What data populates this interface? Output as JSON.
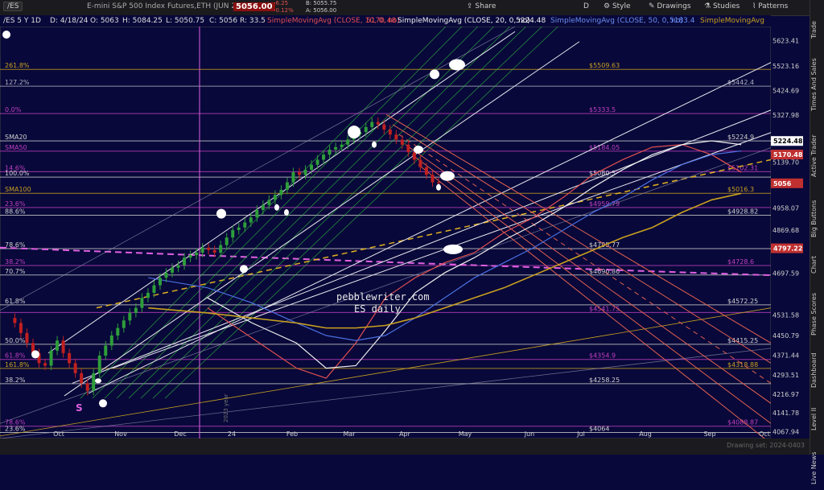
{
  "topbar": {
    "symbol": "/ES",
    "name": "E-mini S&P 500 Index Futures,ETH (JUN 24)",
    "last": "5056.00",
    "change": "-6.25",
    "change_pct": "-0.12%",
    "bid": "B: 5055.75",
    "ask": "A: 5056.00",
    "share": "Share",
    "d": "D",
    "style": "Style",
    "drawings": "Drawings",
    "studies": "Studies",
    "patterns": "Patterns"
  },
  "info": {
    "label": "/ES 5 Y 1D",
    "date": "D: 4/18/24",
    "open": "O: 5063",
    "high": "H: 5084.25",
    "low": "L: 5050.75",
    "close": "C: 5056",
    "range": "R: 33.5",
    "sma10": "SimpleMovingAvg (CLOSE, 10, 0, no)",
    "sma10_val": "5170.48",
    "sma20": "SimpleMovingAvg (CLOSE, 20, 0, no)",
    "sma20_val": "5224.48",
    "sma50": "SimpleMovingAvg (CLOSE, 50, 0, no)",
    "sma50_val": "5183.4",
    "sma100": "SimpleMovingAvg"
  },
  "side_tabs": [
    "Trade",
    "Times And Sales",
    "Active Trader",
    "Big Buttons",
    "Chart",
    "Phase Scores",
    "Dashboard",
    "Level II",
    "Live News"
  ],
  "watermark": {
    "line1": "pebblewriter.com",
    "line2": "ES daily"
  },
  "year_label": "2023 year",
  "drawing_set": "Drawing set: 2024-0403",
  "s_label": "S",
  "colors": {
    "bg": "#08083a",
    "up": "#2e9e3a",
    "down": "#c02020",
    "sma10": "#e05050",
    "sma20": "#f0f0f0",
    "sma50": "#4a6fe0",
    "sma100": "#c8a020",
    "fib": "#c040c0",
    "channel": "#e06050",
    "green_lines": "#30c040"
  },
  "chart_data": {
    "type": "line",
    "title": "",
    "xlabel": "",
    "ylabel": "",
    "x_ticks": [
      "Oct",
      "Nov",
      "Dec",
      "24",
      "Feb",
      "Mar",
      "Apr",
      "May",
      "Jun",
      "Jul",
      "Aug",
      "Sep",
      "Oct"
    ],
    "y_ticks": [
      5623.41,
      5523.16,
      5424.69,
      5327.98,
      5139.7,
      4958.07,
      4869.68,
      4697.59,
      4531.58,
      4450.79,
      4371.44,
      4293.51,
      4216.97,
      4141.78,
      4067.94
    ],
    "ylim": [
      4040,
      5680
    ],
    "price_markers": [
      {
        "label": "5224.48",
        "value": 5224.48,
        "color": "#ffffff"
      },
      {
        "label": "5170.48",
        "value": 5170.48,
        "color": "#c03030"
      },
      {
        "label": "5056",
        "value": 5056,
        "color": "#c03030"
      },
      {
        "label": "4797.22",
        "value": 4797.22,
        "color": "#c03030"
      }
    ],
    "levels": [
      {
        "left": "261.8%",
        "right": "$5509.63",
        "value": 5509.63,
        "color": "#c8a020"
      },
      {
        "left": "127.2%",
        "right": "$5442.4",
        "value": 5442.4,
        "color": "#b0b0c0"
      },
      {
        "left": "0.0%",
        "right": "$5333.5",
        "value": 5333.5,
        "color": "#c040c0"
      },
      {
        "left": "SMA20",
        "right": "$5224.9",
        "value": 5224.9,
        "color": "#d0d0d0"
      },
      {
        "left": "SMA50",
        "right": "$5184.05",
        "value": 5184.05,
        "color": "#c040c0"
      },
      {
        "left": "14.6%",
        "right": "$5102.31",
        "value": 5102.31,
        "color": "#c040c0"
      },
      {
        "left": "100.0%",
        "right": "$5080.5",
        "value": 5080.5,
        "color": "#d0d0d0"
      },
      {
        "left": "SMA100",
        "right": "$5016.3",
        "value": 5016.3,
        "color": "#c8a020"
      },
      {
        "left": "23.6%",
        "right": "$4959.79",
        "value": 4959.79,
        "color": "#c040c0"
      },
      {
        "left": "88.6%",
        "right": "$4928.82",
        "value": 4928.82,
        "color": "#d0d0d0"
      },
      {
        "left": "78.6%",
        "right": "$4795.77",
        "value": 4795.77,
        "color": "#d0d0d0"
      },
      {
        "left": "38.2%",
        "right": "$4728.6",
        "value": 4728.6,
        "color": "#c040c0"
      },
      {
        "left": "70.7%",
        "right": "$4690.86",
        "value": 4690.86,
        "color": "#d0d0d0"
      },
      {
        "left": "61.8%",
        "right": "$4572.25",
        "value": 4572.25,
        "color": "#d0d0d0"
      },
      {
        "left": "",
        "right": "$4541.75",
        "value": 4541.75,
        "color": "#c040c0"
      },
      {
        "left": "50.0%",
        "right": "$4415.25",
        "value": 4415.25,
        "color": "#d0d0d0"
      },
      {
        "left": "61.8%",
        "right": "$4354.9",
        "value": 4354.9,
        "color": "#c040c0"
      },
      {
        "left": "161.8%",
        "right": "$4318.88",
        "value": 4318.88,
        "color": "#c8a020"
      },
      {
        "left": "38.2%",
        "right": "$4258.25",
        "value": 4258.25,
        "color": "#d0d0d0"
      },
      {
        "left": "78.6%",
        "right": "$4088.87",
        "value": 4088.87,
        "color": "#c040c0"
      },
      {
        "left": "23.6%",
        "right": "$4064",
        "value": 4064,
        "color": "#d0d0d0"
      }
    ],
    "series": [
      {
        "name": "SMA10",
        "color": "#e05050",
        "x": [
          28,
          34,
          40,
          44,
          48,
          52,
          56,
          60,
          64,
          68,
          72,
          76,
          80,
          84,
          88,
          92,
          96,
          100
        ],
        "y": [
          4560,
          4440,
          4320,
          4280,
          4420,
          4600,
          4680,
          4740,
          4780,
          4860,
          4920,
          5000,
          5090,
          5150,
          5200,
          5210,
          5170,
          5100
        ]
      },
      {
        "name": "SMA20",
        "color": "#f0f0f0",
        "x": [
          28,
          34,
          40,
          44,
          48,
          52,
          56,
          60,
          64,
          68,
          72,
          76,
          80,
          84,
          88,
          92,
          96,
          100
        ],
        "y": [
          4600,
          4500,
          4420,
          4320,
          4330,
          4470,
          4620,
          4700,
          4760,
          4830,
          4890,
          4960,
          5040,
          5110,
          5170,
          5210,
          5225,
          5210
        ]
      },
      {
        "name": "SMA50",
        "color": "#4a6fe0",
        "x": [
          20,
          28,
          34,
          40,
          44,
          48,
          52,
          56,
          60,
          64,
          68,
          72,
          76,
          80,
          84,
          88,
          92,
          96,
          100
        ],
        "y": [
          4680,
          4640,
          4580,
          4500,
          4450,
          4430,
          4450,
          4520,
          4600,
          4680,
          4740,
          4800,
          4870,
          4940,
          5000,
          5070,
          5130,
          5170,
          5185
        ]
      },
      {
        "name": "SMA100",
        "color": "#c8a020",
        "x": [
          20,
          28,
          34,
          40,
          44,
          48,
          52,
          56,
          60,
          64,
          68,
          72,
          76,
          80,
          84,
          88,
          92,
          96,
          100
        ],
        "y": [
          4560,
          4540,
          4520,
          4500,
          4480,
          4480,
          4490,
          4520,
          4560,
          4600,
          4640,
          4690,
          4740,
          4790,
          4840,
          4880,
          4940,
          4990,
          5016
        ]
      }
    ],
    "candles": {
      "start_x": 2,
      "end_x": 101,
      "close": [
        4500,
        4460,
        4420,
        4380,
        4340,
        4330,
        4390,
        4430,
        4380,
        4340,
        4300,
        4260,
        4230,
        4300,
        4370,
        4410,
        4450,
        4480,
        4510,
        4540,
        4560,
        4600,
        4620,
        4650,
        4680,
        4700,
        4720,
        4730,
        4760,
        4770,
        4780,
        4800,
        4790,
        4780,
        4810,
        4840,
        4870,
        4880,
        4900,
        4920,
        4950,
        4970,
        4990,
        5010,
        5030,
        5060,
        5100,
        5090,
        5110,
        5130,
        5150,
        5170,
        5190,
        5200,
        5210,
        5230,
        5250,
        5260,
        5280,
        5300,
        5290,
        5270,
        5250,
        5230,
        5210,
        5180,
        5150,
        5120,
        5090,
        5060,
        5056
      ]
    },
    "annotations": [
      "pebblewriter.com",
      "ES daily"
    ]
  }
}
